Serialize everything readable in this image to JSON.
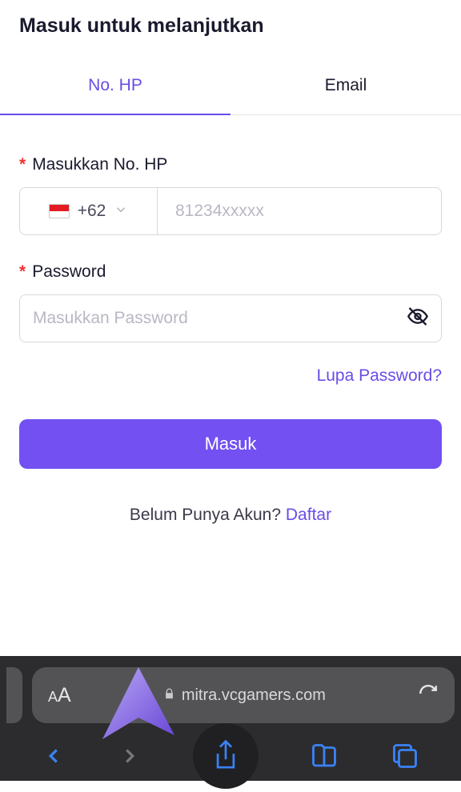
{
  "title": "Masuk untuk melanjutkan",
  "tabs": {
    "phone": "No. HP",
    "email": "Email"
  },
  "phone": {
    "label": "Masukkan No. HP",
    "dialcode": "+62",
    "placeholder": "81234xxxxx"
  },
  "password": {
    "label": "Password",
    "placeholder": "Masukkan Password"
  },
  "forgot": "Lupa Password?",
  "login": "Masuk",
  "noAccount": "Belum Punya Akun? ",
  "register": "Daftar",
  "url": "mitra.vcgamers.com",
  "aa": {
    "small": "A",
    "big": "A"
  }
}
